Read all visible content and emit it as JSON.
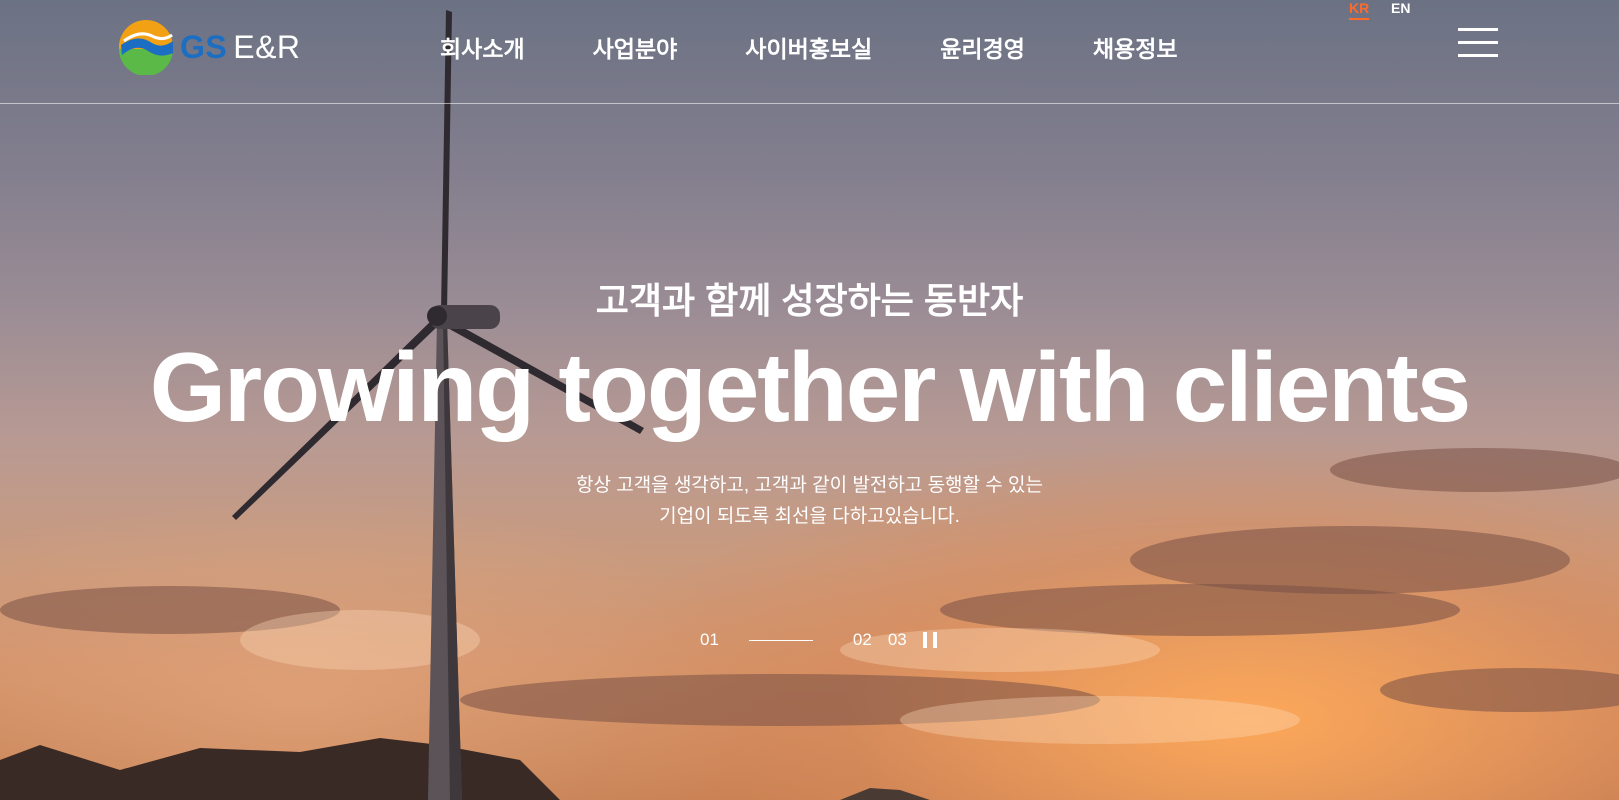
{
  "brand": {
    "name_gs": "GS",
    "name_er": "E&R"
  },
  "nav": [
    {
      "label": "회사소개"
    },
    {
      "label": "사업분야"
    },
    {
      "label": "사이버홍보실"
    },
    {
      "label": "윤리경영"
    },
    {
      "label": "채용정보"
    }
  ],
  "lang": {
    "kr": "KR",
    "en": "EN",
    "active": "KR",
    "active_color": "#ff6a2b"
  },
  "menu_icon": "hamburger-menu-icon",
  "hero": {
    "kicker": "고객과 함께 성장하는 동반자",
    "title": "Growing together with clients",
    "desc_line1": "항상 고객을 생각하고, 고객과 같이 발전하고 동행할 수 있는",
    "desc_line2": "기업이 되도록 최선을 다하고있습니다."
  },
  "pager": {
    "current": "01",
    "next": "02",
    "last": "03",
    "pause_icon": "pause-icon"
  },
  "colors": {
    "accent": "#ff6a2b",
    "logo_blue": "#1b6ec2"
  }
}
